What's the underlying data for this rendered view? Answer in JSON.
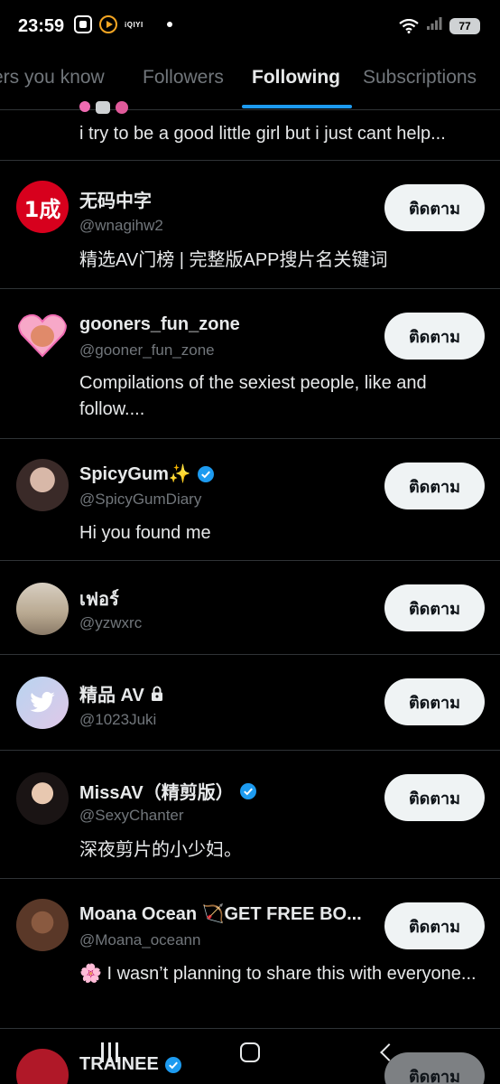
{
  "status_bar": {
    "time": "23:59",
    "app_label": "iQIYI",
    "battery": "77"
  },
  "tabs": [
    {
      "label": "ers you know"
    },
    {
      "label": "Followers"
    },
    {
      "label": "Following"
    },
    {
      "label": "Subscriptions"
    }
  ],
  "active_tab": "Following",
  "follow_label": "ติดตาม",
  "accounts": [
    {
      "name": "",
      "handle": "",
      "bio": "i try to be a good little girl but i just cant help..."
    },
    {
      "name": "无码中字",
      "handle": "@wnagihw2",
      "bio": "精选AV门榜 | 完整版APP搜片名关键词",
      "avatar_text": "1成",
      "avatar_color": "#d7001d"
    },
    {
      "name": "gooners_fun_zone",
      "handle": "@gooner_fun_zone",
      "bio": "Compilations of the sexiest people, like and follow....",
      "avatar_color": "#f7a8c8"
    },
    {
      "name": "SpicyGum✨",
      "handle": "@SpicyGumDiary",
      "bio": "Hi you found me",
      "verified": true,
      "avatar_color": "#3a2a28"
    },
    {
      "name": "เฟอร์",
      "handle": "@yzwxrc",
      "bio": "",
      "avatar_color": "#c8b49a"
    },
    {
      "name": "精品 AV",
      "handle": "@1023Juki",
      "bio": "",
      "locked": true,
      "avatar_color": "#b8d4f0"
    },
    {
      "name": "MissAV（精剪版）",
      "handle": "@SexyChanter",
      "bio": "深夜剪片的小少妇。",
      "verified": true,
      "avatar_color": "#2a2020"
    },
    {
      "name": "Moana Ocean 🏹GET FREE BO...",
      "handle": "@Moana_oceann",
      "bio": "🌸 I wasn’t planning to share this with everyone...",
      "avatar_color": "#6a4030"
    },
    {
      "name": "TRAINEE",
      "handle": "",
      "bio": "",
      "verified": true,
      "avatar_color": "#b01828"
    }
  ],
  "colors": {
    "background": "#000000",
    "text": "#e7e9ea",
    "secondary_text": "#71767b",
    "accent": "#1d9bf0",
    "divider": "#2f3336",
    "button_bg": "#eff3f4"
  }
}
